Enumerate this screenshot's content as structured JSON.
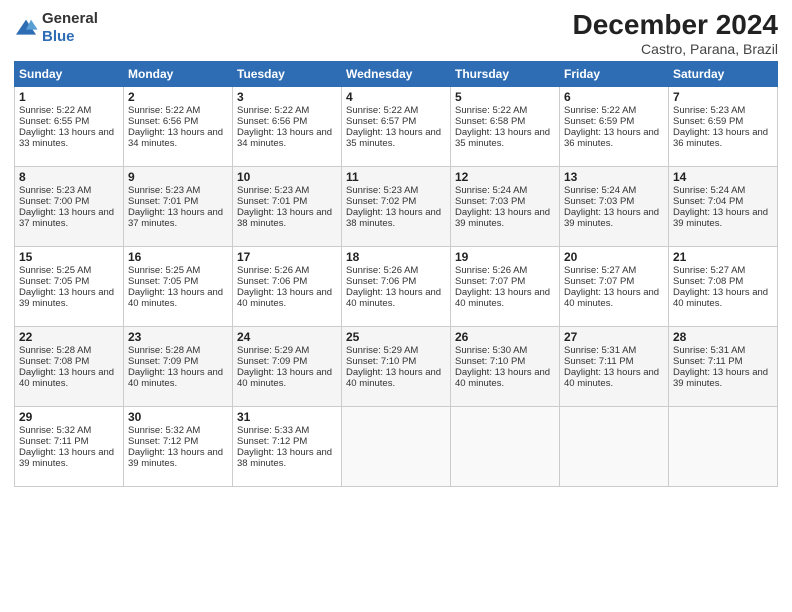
{
  "header": {
    "logo_general": "General",
    "logo_blue": "Blue",
    "month_title": "December 2024",
    "location": "Castro, Parana, Brazil"
  },
  "calendar": {
    "days_of_week": [
      "Sunday",
      "Monday",
      "Tuesday",
      "Wednesday",
      "Thursday",
      "Friday",
      "Saturday"
    ],
    "weeks": [
      [
        {
          "day": "1",
          "sunrise": "Sunrise: 5:22 AM",
          "sunset": "Sunset: 6:55 PM",
          "daylight": "Daylight: 13 hours and 33 minutes."
        },
        {
          "day": "2",
          "sunrise": "Sunrise: 5:22 AM",
          "sunset": "Sunset: 6:56 PM",
          "daylight": "Daylight: 13 hours and 34 minutes."
        },
        {
          "day": "3",
          "sunrise": "Sunrise: 5:22 AM",
          "sunset": "Sunset: 6:56 PM",
          "daylight": "Daylight: 13 hours and 34 minutes."
        },
        {
          "day": "4",
          "sunrise": "Sunrise: 5:22 AM",
          "sunset": "Sunset: 6:57 PM",
          "daylight": "Daylight: 13 hours and 35 minutes."
        },
        {
          "day": "5",
          "sunrise": "Sunrise: 5:22 AM",
          "sunset": "Sunset: 6:58 PM",
          "daylight": "Daylight: 13 hours and 35 minutes."
        },
        {
          "day": "6",
          "sunrise": "Sunrise: 5:22 AM",
          "sunset": "Sunset: 6:59 PM",
          "daylight": "Daylight: 13 hours and 36 minutes."
        },
        {
          "day": "7",
          "sunrise": "Sunrise: 5:23 AM",
          "sunset": "Sunset: 6:59 PM",
          "daylight": "Daylight: 13 hours and 36 minutes."
        }
      ],
      [
        {
          "day": "8",
          "sunrise": "Sunrise: 5:23 AM",
          "sunset": "Sunset: 7:00 PM",
          "daylight": "Daylight: 13 hours and 37 minutes."
        },
        {
          "day": "9",
          "sunrise": "Sunrise: 5:23 AM",
          "sunset": "Sunset: 7:01 PM",
          "daylight": "Daylight: 13 hours and 37 minutes."
        },
        {
          "day": "10",
          "sunrise": "Sunrise: 5:23 AM",
          "sunset": "Sunset: 7:01 PM",
          "daylight": "Daylight: 13 hours and 38 minutes."
        },
        {
          "day": "11",
          "sunrise": "Sunrise: 5:23 AM",
          "sunset": "Sunset: 7:02 PM",
          "daylight": "Daylight: 13 hours and 38 minutes."
        },
        {
          "day": "12",
          "sunrise": "Sunrise: 5:24 AM",
          "sunset": "Sunset: 7:03 PM",
          "daylight": "Daylight: 13 hours and 39 minutes."
        },
        {
          "day": "13",
          "sunrise": "Sunrise: 5:24 AM",
          "sunset": "Sunset: 7:03 PM",
          "daylight": "Daylight: 13 hours and 39 minutes."
        },
        {
          "day": "14",
          "sunrise": "Sunrise: 5:24 AM",
          "sunset": "Sunset: 7:04 PM",
          "daylight": "Daylight: 13 hours and 39 minutes."
        }
      ],
      [
        {
          "day": "15",
          "sunrise": "Sunrise: 5:25 AM",
          "sunset": "Sunset: 7:05 PM",
          "daylight": "Daylight: 13 hours and 39 minutes."
        },
        {
          "day": "16",
          "sunrise": "Sunrise: 5:25 AM",
          "sunset": "Sunset: 7:05 PM",
          "daylight": "Daylight: 13 hours and 40 minutes."
        },
        {
          "day": "17",
          "sunrise": "Sunrise: 5:26 AM",
          "sunset": "Sunset: 7:06 PM",
          "daylight": "Daylight: 13 hours and 40 minutes."
        },
        {
          "day": "18",
          "sunrise": "Sunrise: 5:26 AM",
          "sunset": "Sunset: 7:06 PM",
          "daylight": "Daylight: 13 hours and 40 minutes."
        },
        {
          "day": "19",
          "sunrise": "Sunrise: 5:26 AM",
          "sunset": "Sunset: 7:07 PM",
          "daylight": "Daylight: 13 hours and 40 minutes."
        },
        {
          "day": "20",
          "sunrise": "Sunrise: 5:27 AM",
          "sunset": "Sunset: 7:07 PM",
          "daylight": "Daylight: 13 hours and 40 minutes."
        },
        {
          "day": "21",
          "sunrise": "Sunrise: 5:27 AM",
          "sunset": "Sunset: 7:08 PM",
          "daylight": "Daylight: 13 hours and 40 minutes."
        }
      ],
      [
        {
          "day": "22",
          "sunrise": "Sunrise: 5:28 AM",
          "sunset": "Sunset: 7:08 PM",
          "daylight": "Daylight: 13 hours and 40 minutes."
        },
        {
          "day": "23",
          "sunrise": "Sunrise: 5:28 AM",
          "sunset": "Sunset: 7:09 PM",
          "daylight": "Daylight: 13 hours and 40 minutes."
        },
        {
          "day": "24",
          "sunrise": "Sunrise: 5:29 AM",
          "sunset": "Sunset: 7:09 PM",
          "daylight": "Daylight: 13 hours and 40 minutes."
        },
        {
          "day": "25",
          "sunrise": "Sunrise: 5:29 AM",
          "sunset": "Sunset: 7:10 PM",
          "daylight": "Daylight: 13 hours and 40 minutes."
        },
        {
          "day": "26",
          "sunrise": "Sunrise: 5:30 AM",
          "sunset": "Sunset: 7:10 PM",
          "daylight": "Daylight: 13 hours and 40 minutes."
        },
        {
          "day": "27",
          "sunrise": "Sunrise: 5:31 AM",
          "sunset": "Sunset: 7:11 PM",
          "daylight": "Daylight: 13 hours and 40 minutes."
        },
        {
          "day": "28",
          "sunrise": "Sunrise: 5:31 AM",
          "sunset": "Sunset: 7:11 PM",
          "daylight": "Daylight: 13 hours and 39 minutes."
        }
      ],
      [
        {
          "day": "29",
          "sunrise": "Sunrise: 5:32 AM",
          "sunset": "Sunset: 7:11 PM",
          "daylight": "Daylight: 13 hours and 39 minutes."
        },
        {
          "day": "30",
          "sunrise": "Sunrise: 5:32 AM",
          "sunset": "Sunset: 7:12 PM",
          "daylight": "Daylight: 13 hours and 39 minutes."
        },
        {
          "day": "31",
          "sunrise": "Sunrise: 5:33 AM",
          "sunset": "Sunset: 7:12 PM",
          "daylight": "Daylight: 13 hours and 38 minutes."
        },
        {
          "day": "",
          "sunrise": "",
          "sunset": "",
          "daylight": ""
        },
        {
          "day": "",
          "sunrise": "",
          "sunset": "",
          "daylight": ""
        },
        {
          "day": "",
          "sunrise": "",
          "sunset": "",
          "daylight": ""
        },
        {
          "day": "",
          "sunrise": "",
          "sunset": "",
          "daylight": ""
        }
      ]
    ]
  }
}
